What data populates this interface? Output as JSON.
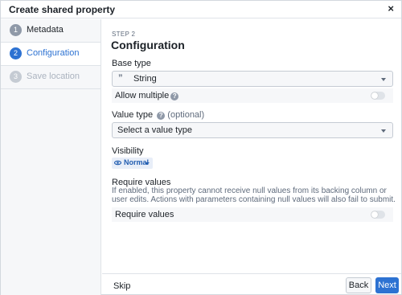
{
  "dialog": {
    "title": "Create shared property",
    "close_glyph": "×"
  },
  "sidebar": {
    "steps": [
      {
        "number": "1",
        "label": "Metadata",
        "state": "done"
      },
      {
        "number": "2",
        "label": "Configuration",
        "state": "active"
      },
      {
        "number": "3",
        "label": "Save location",
        "state": "future"
      }
    ]
  },
  "main": {
    "step_label": "STEP 2",
    "title": "Configuration",
    "base_type": {
      "label": "Base type",
      "icon_glyph": "”",
      "icon": "quote-icon",
      "value": "String"
    },
    "allow_multiple": {
      "label": "Allow multiple",
      "help_glyph": "?",
      "enabled": false
    },
    "value_type": {
      "label": "Value type",
      "help_glyph": "?",
      "optional": "(optional)",
      "placeholder": "Select a value type"
    },
    "visibility": {
      "label": "Visibility",
      "value": "Normal",
      "icon": "eye-icon"
    },
    "require_values": {
      "heading": "Require values",
      "description": "If enabled, this property cannot receive null values from its backing column or user edits. Actions with parameters containing null values will also fail to submit.",
      "toggle_label": "Require values",
      "enabled": false
    }
  },
  "footer": {
    "skip": "Skip",
    "back": "Back",
    "next": "Next"
  },
  "colors": {
    "accent": "#2d72d2",
    "sidebar_bg": "#f6f7f9",
    "border": "#dfe3e8"
  }
}
